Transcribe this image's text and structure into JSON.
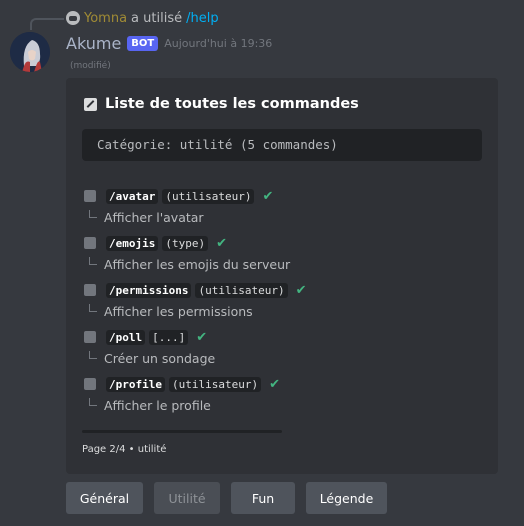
{
  "reply": {
    "user": "Yomna",
    "action": "a utilisé",
    "command": "/help"
  },
  "message": {
    "author": "Akume",
    "bot_tag": "BOT",
    "timestamp": "Aujourd'hui à 19:36",
    "edited": "(modifié)"
  },
  "embed": {
    "title": "Liste de toutes les commandes",
    "category": "Catégorie: utilité (5 commandes)",
    "commands": [
      {
        "name": "/avatar",
        "arg": "(utilisateur)",
        "description": "Afficher l'avatar"
      },
      {
        "name": "/emojis",
        "arg": "(type)",
        "description": "Afficher les emojis du serveur"
      },
      {
        "name": "/permissions",
        "arg": "(utilisateur)",
        "description": "Afficher les permissions"
      },
      {
        "name": "/poll",
        "arg": "[...]",
        "description": "Créer un sondage"
      },
      {
        "name": "/profile",
        "arg": "(utilisateur)",
        "description": "Afficher le profile"
      }
    ],
    "footer": "Page 2/4 • utilité"
  },
  "buttons": {
    "general": "Général",
    "utilite": "Utilité",
    "fun": "Fun",
    "legende": "Légende"
  },
  "colors": {
    "background": "#36393f",
    "embed_bg": "#2f3136",
    "accent_bot": "#5865f2",
    "check": "#43b581",
    "link": "#00aff4"
  }
}
